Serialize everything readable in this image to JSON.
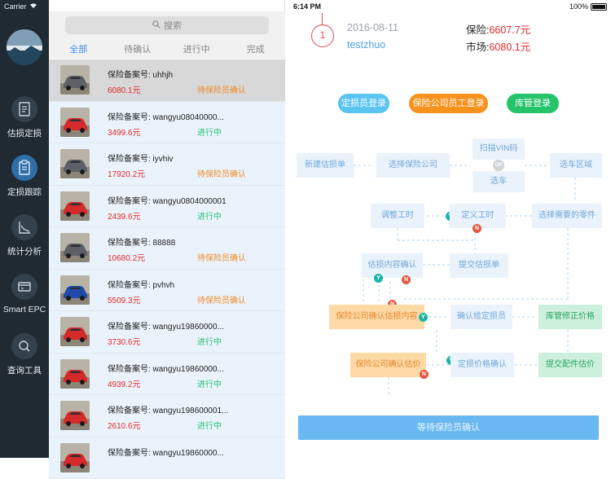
{
  "status_bar": {
    "carrier": "Carrier",
    "time": "6:14 PM",
    "battery": "100%"
  },
  "rail": {
    "items": [
      {
        "label": "估损定损",
        "icon": "document-icon"
      },
      {
        "label": "定损跟踪",
        "icon": "clipboard-icon",
        "active": true
      },
      {
        "label": "统计分析",
        "icon": "chart-icon"
      },
      {
        "label": "Smart EPC",
        "icon": "card-icon"
      },
      {
        "label": "查询工具",
        "icon": "search-icon"
      }
    ]
  },
  "list": {
    "search_placeholder": "搜索",
    "tabs": [
      "全部",
      "待确认",
      "进行中",
      "完成"
    ],
    "rows": [
      {
        "title": "保险备案号: uhhjh",
        "price": "6080.1元",
        "status": "待保险员确认",
        "status_kind": "orange",
        "car": "gray"
      },
      {
        "title": "保险备案号: wangyu08040000...",
        "price": "3499.6元",
        "status": "进行中",
        "status_kind": "green",
        "car": "red"
      },
      {
        "title": "保险备案号: iyvhiv",
        "price": "17920.2元",
        "status": "待保险员确认",
        "status_kind": "orange",
        "car": "gray"
      },
      {
        "title": "保险备案号: wangyu0804000001",
        "price": "2439.6元",
        "status": "进行中",
        "status_kind": "green",
        "car": "red"
      },
      {
        "title": "保险备案号: 88888",
        "price": "10680.2元",
        "status": "待保险员确认",
        "status_kind": "orange",
        "car": "gray"
      },
      {
        "title": "保险备案号: pvhvh",
        "price": "5509.3元",
        "status": "待保险员确认",
        "status_kind": "orange",
        "car": "blue"
      },
      {
        "title": "保险备案号: wangyu19860000...",
        "price": "3730.6元",
        "status": "进行中",
        "status_kind": "green",
        "car": "red"
      },
      {
        "title": "保险备案号: wangyu19860000...",
        "price": "4939.2元",
        "status": "进行中",
        "status_kind": "green",
        "car": "red"
      },
      {
        "title": "保险备案号: wangyu198600001...",
        "price": "2610.6元",
        "status": "进行中",
        "status_kind": "green",
        "car": "red"
      },
      {
        "title": "保险备案号: wangyu19860000...",
        "price": "",
        "status": "",
        "status_kind": "green",
        "car": "red"
      }
    ]
  },
  "detail": {
    "step": "1",
    "date": "2016-08-11",
    "user": "testzhuo",
    "insurance_label": "保险:",
    "insurance_value": "6607.7元",
    "market_label": "市场:",
    "market_value": "6080.1元",
    "pills": {
      "assessor_login": "定损员登录",
      "insurer_login": "保险公司员工登录",
      "warehouse_login": "库管登录"
    },
    "flow": {
      "new_estimate": "新建估损单",
      "choose_insurer": "选择保险公司",
      "scan_vin": "扫描VIN码",
      "or": "OR",
      "choose_car": "选车",
      "choose_area": "选车区域",
      "adjust_hours": "调整工时",
      "define_hours": "定义工时",
      "choose_parts": "选择需要的零件",
      "confirm_estimate": "估损内容确认",
      "submit_estimate": "提交估损单",
      "insurer_confirm_content": "保险公司确认估损内容",
      "confirm_assessor": "确认给定损员",
      "warehouse_fix_price": "库管修正价格",
      "insurer_confirm_price": "保险公司确认估价",
      "assess_price_confirm": "定损价格确认",
      "submit_parts_price": "提交配件估价",
      "y": "Y",
      "n": "N"
    },
    "wait_button": "等待保险员确认"
  }
}
